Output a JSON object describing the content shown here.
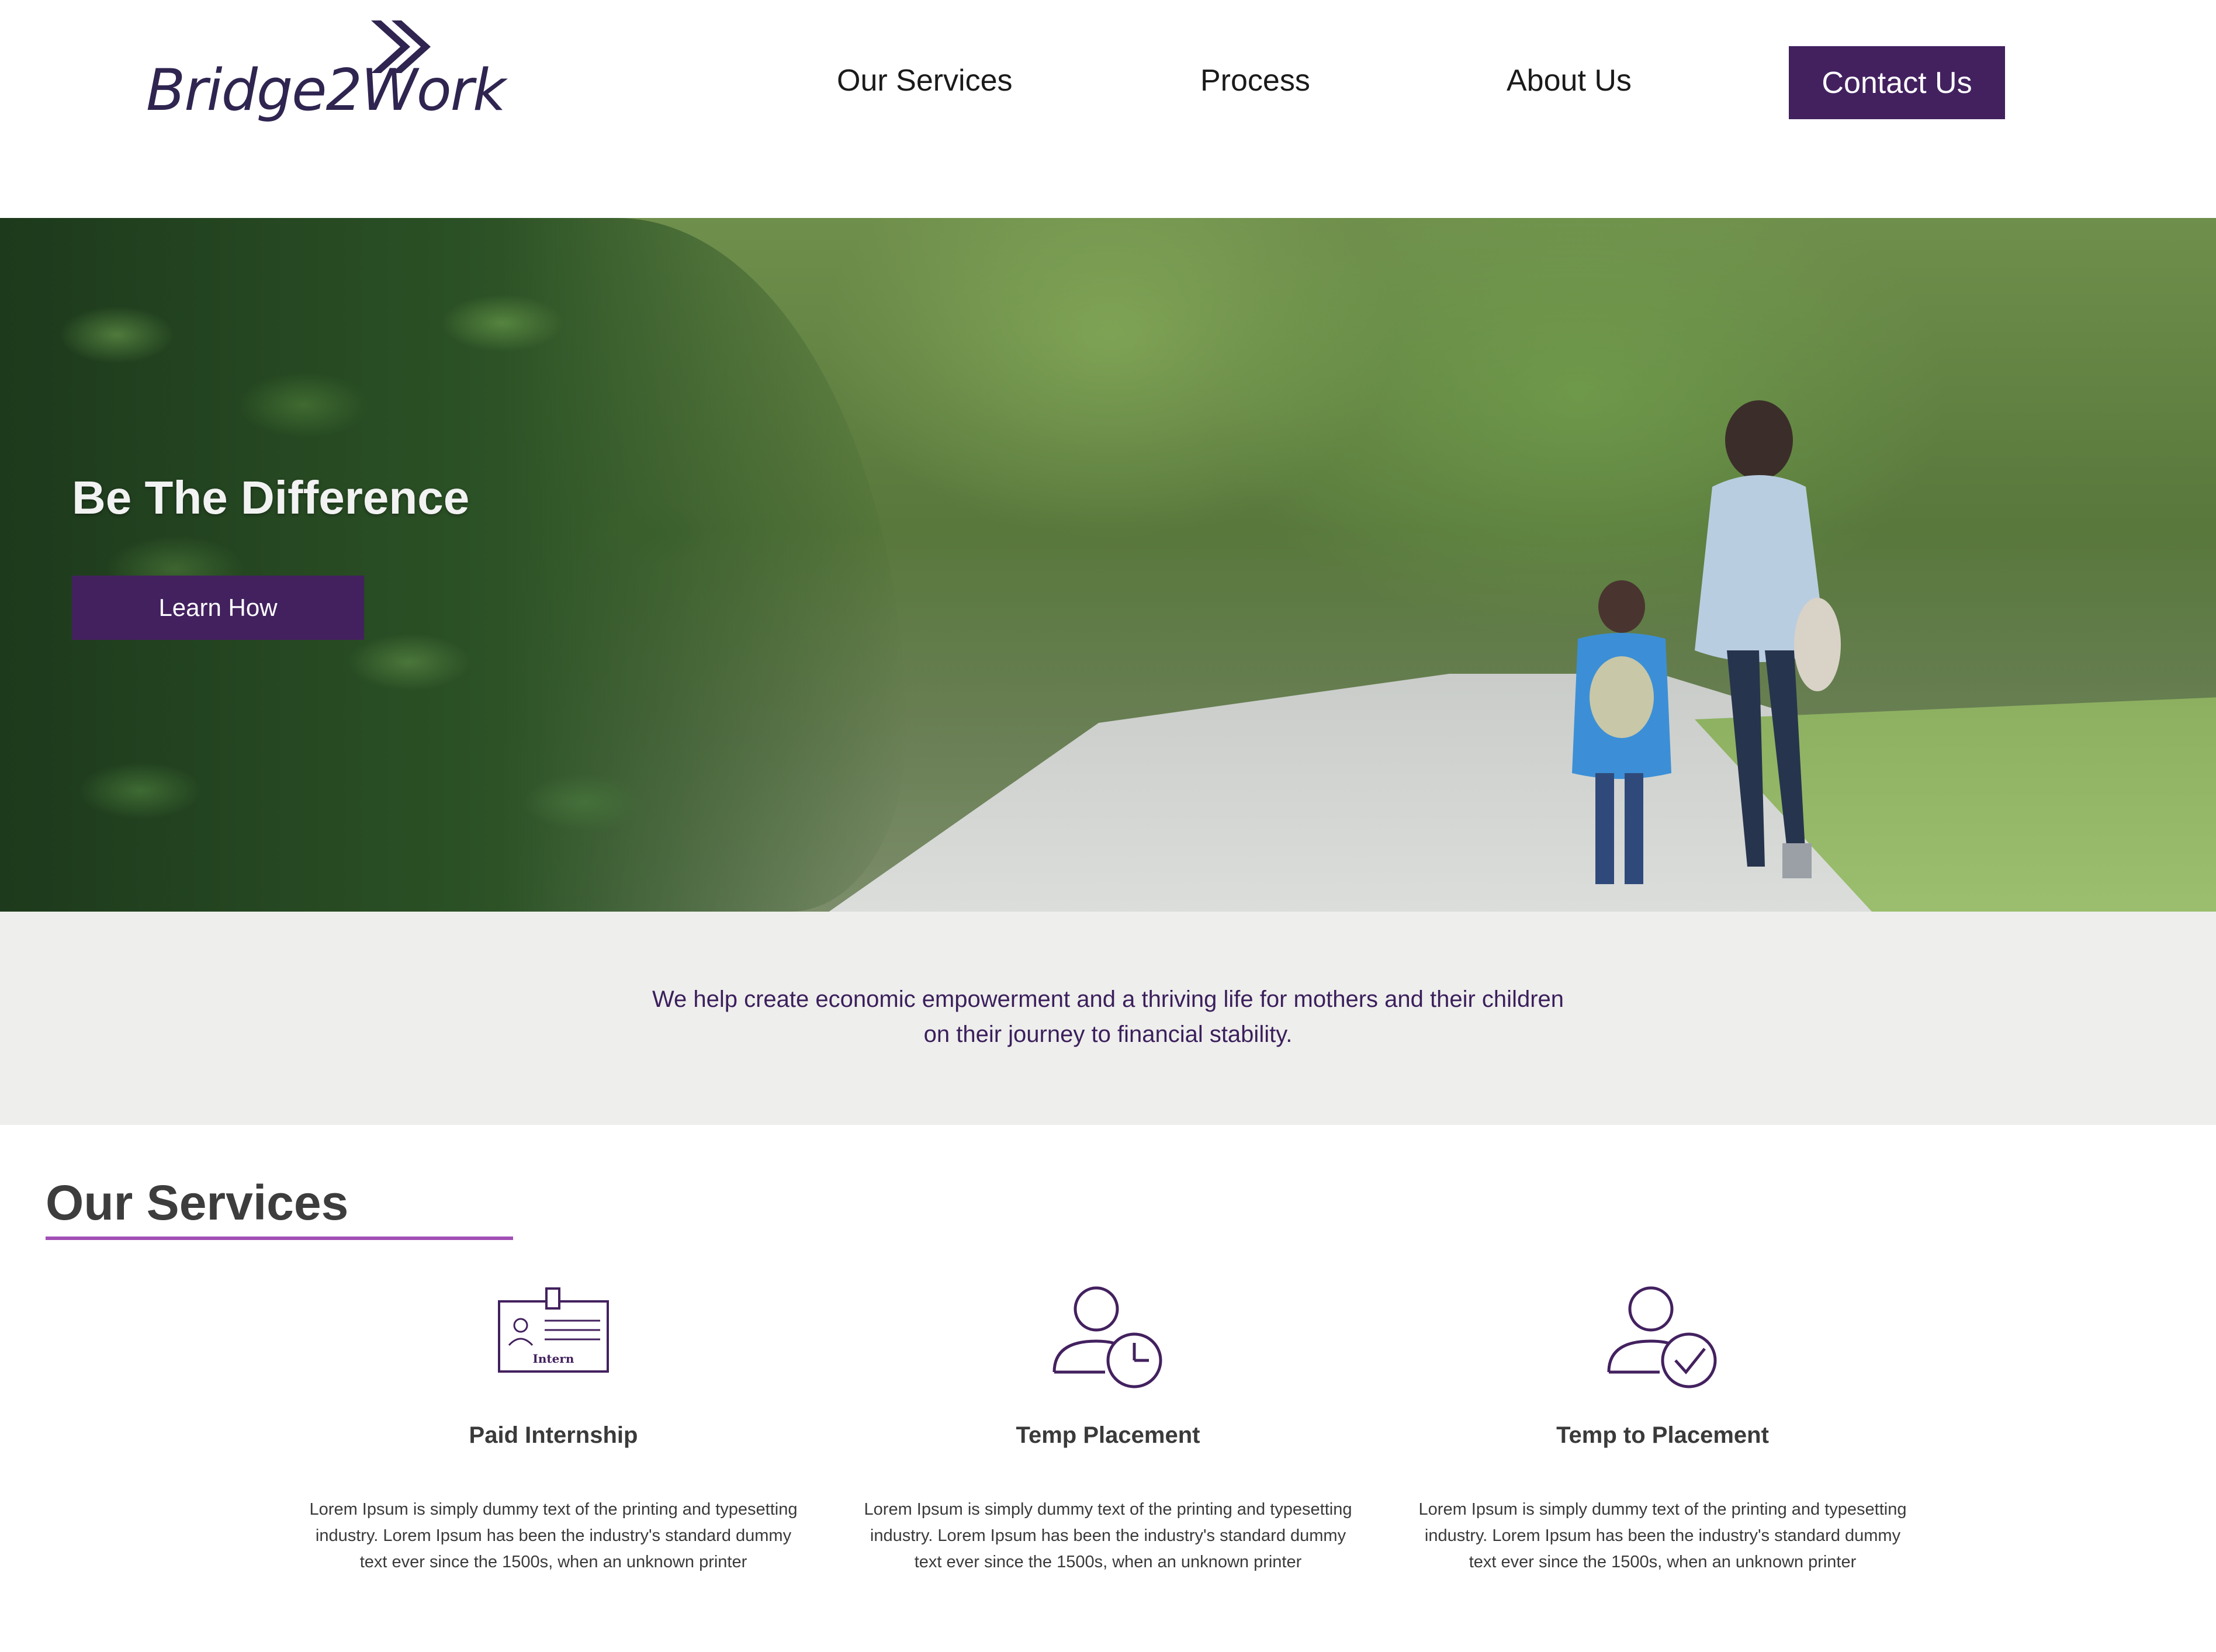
{
  "header": {
    "logo_text": "Bridge2Work",
    "nav": {
      "services": "Our Services",
      "process": "Process",
      "about": "About Us"
    },
    "contact_label": "Contact Us"
  },
  "hero": {
    "title": "Be The Difference",
    "button_label": "Learn How"
  },
  "mission": {
    "text": "We help create economic empowerment and a thriving life for mothers and their children on their journey to financial stability."
  },
  "services": {
    "heading": "Our Services",
    "items": [
      {
        "icon": "intern-badge-icon",
        "icon_text": "Intern",
        "title": "Paid Internship",
        "description": "Lorem Ipsum is simply dummy text of the printing and typesetting industry. Lorem Ipsum has been the industry's standard dummy text ever since the 1500s, when an unknown printer"
      },
      {
        "icon": "person-clock-icon",
        "title": "Temp Placement",
        "description": "Lorem Ipsum is simply dummy text of the printing and typesetting industry. Lorem Ipsum has been the industry's standard dummy text ever since the 1500s, when an unknown printer"
      },
      {
        "icon": "person-check-icon",
        "title": "Temp to Placement",
        "description": "Lorem Ipsum is simply dummy text of the printing and typesetting industry. Lorem Ipsum has been the industry's standard dummy text ever since the 1500s, when an unknown printer"
      }
    ]
  },
  "colors": {
    "brand_purple": "#43215f",
    "logo_purple": "#2f2550",
    "accent_underline": "#a24fb5",
    "mission_bg": "#eeeeec"
  }
}
